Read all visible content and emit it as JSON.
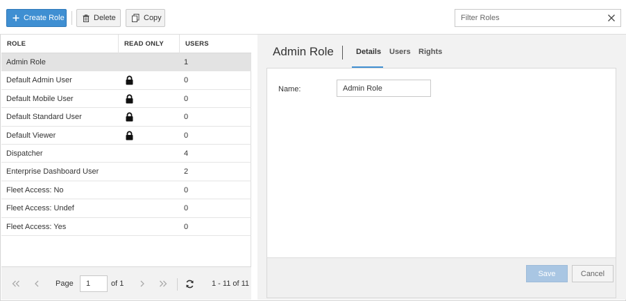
{
  "toolbar": {
    "create_label": "Create Role",
    "delete_label": "Delete",
    "copy_label": "Copy",
    "filter_placeholder": "Filter Roles"
  },
  "grid": {
    "columns": [
      "ROLE",
      "READ ONLY",
      "USERS"
    ],
    "rows": [
      {
        "name": "Admin Role",
        "read_only": false,
        "users": "1",
        "selected": true
      },
      {
        "name": "Default Admin User",
        "read_only": true,
        "users": "0",
        "selected": false
      },
      {
        "name": "Default Mobile User",
        "read_only": true,
        "users": "0",
        "selected": false
      },
      {
        "name": "Default Standard User",
        "read_only": true,
        "users": "0",
        "selected": false
      },
      {
        "name": "Default Viewer",
        "read_only": true,
        "users": "0",
        "selected": false
      },
      {
        "name": "Dispatcher",
        "read_only": false,
        "users": "4",
        "selected": false
      },
      {
        "name": "Enterprise Dashboard User",
        "read_only": false,
        "users": "2",
        "selected": false
      },
      {
        "name": "Fleet Access: No",
        "read_only": false,
        "users": "0",
        "selected": false
      },
      {
        "name": "Fleet Access: Undef",
        "read_only": false,
        "users": "0",
        "selected": false
      },
      {
        "name": "Fleet Access: Yes",
        "read_only": false,
        "users": "0",
        "selected": false
      }
    ]
  },
  "pager": {
    "page_label": "Page",
    "page_value": "1",
    "of_label": "of 1",
    "range_label": "1 - 11 of 11"
  },
  "detail": {
    "title": "Admin Role",
    "tabs": [
      "Details",
      "Users",
      "Rights"
    ],
    "active_tab": "Details",
    "name_label": "Name:",
    "name_value": "Admin Role",
    "save_label": "Save",
    "cancel_label": "Cancel"
  },
  "colors": {
    "primary": "#3f8fd2",
    "selected_row": "#e3e3e3",
    "save_disabled": "#a9c6e3"
  },
  "icons": {
    "create": "plus-icon",
    "delete": "trash-icon",
    "copy": "copy-icon",
    "clear": "close-icon",
    "read_only": "lock-icon",
    "first": "double-chevron-left-icon",
    "prev": "chevron-left-icon",
    "next": "chevron-right-icon",
    "last": "double-chevron-right-icon",
    "refresh": "refresh-icon"
  }
}
